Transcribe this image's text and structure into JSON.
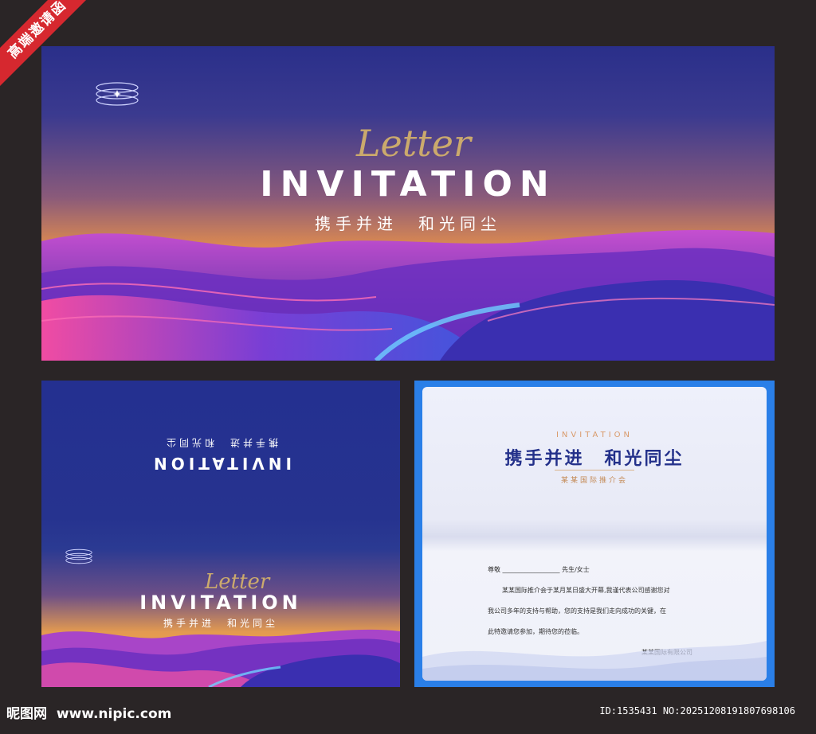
{
  "badge": {
    "label": "高端邀请函"
  },
  "top_card": {
    "title": "INVITATION",
    "script_word": "Letter",
    "subtitle": "携手并进　和光同尘"
  },
  "back_cover": {
    "mirrored_subtitle": "携手并进　和光同尘",
    "mirrored_title": "INVITATION",
    "title": "INVITATION",
    "script_word": "Letter",
    "subtitle": "携手并进　和光同尘"
  },
  "inner_card": {
    "header_en": "INVITATION",
    "headline": "携手并进　和光同尘",
    "event_name": "某某国际推介会",
    "salutation_prefix": "尊敬",
    "salutation_blank": "__________________",
    "salutation_suffix": "先生/女士",
    "body_line1": "某某国际推介会于某月某日盛大开幕,我谨代表公司感谢您对",
    "body_line2": "我公司多年的支持与帮助，您的支持是我们走向成功的关键，在",
    "body_line3": "此特邀请您参加，期待您的莅临。",
    "signature": "某某国际有限公司"
  },
  "footer": {
    "site_name": "昵图网",
    "site_url": "www.nipic.com",
    "image_id": "ID:1535431 NO:20251208191807698106"
  },
  "colors": {
    "accent_orange": "#f0a04a",
    "deep_blue": "#26338f",
    "frame_blue": "#2a7fe8",
    "gold": "#d8b56a"
  },
  "icons": [
    "ring-logo-icon",
    "sparkle-icon"
  ]
}
